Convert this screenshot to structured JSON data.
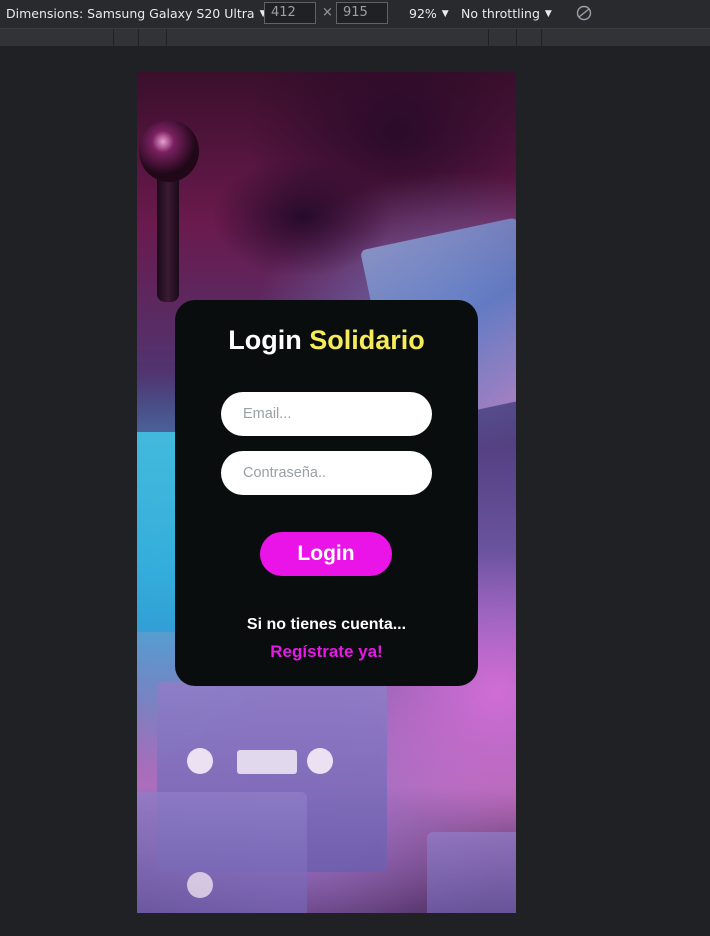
{
  "devtools": {
    "dimensions_label": "Dimensions: Samsung Galaxy S20 Ultra",
    "width_value": "412",
    "height_value": "915",
    "times_symbol": "×",
    "zoom": "92%",
    "throttling": "No throttling",
    "caret": "▼"
  },
  "login": {
    "title_part1": "Login",
    "title_part2": "Solidario",
    "email_placeholder": "Email...",
    "password_placeholder": "Contraseña..",
    "login_button": "Login",
    "no_account_text": "Si no tienes cuenta...",
    "register_link": "Regístrate ya!"
  },
  "colors": {
    "card_bg": "#0a0d0e",
    "title_accent": "#f6ec5a",
    "button_bg": "#ea14e8",
    "link": "#e819e6"
  }
}
